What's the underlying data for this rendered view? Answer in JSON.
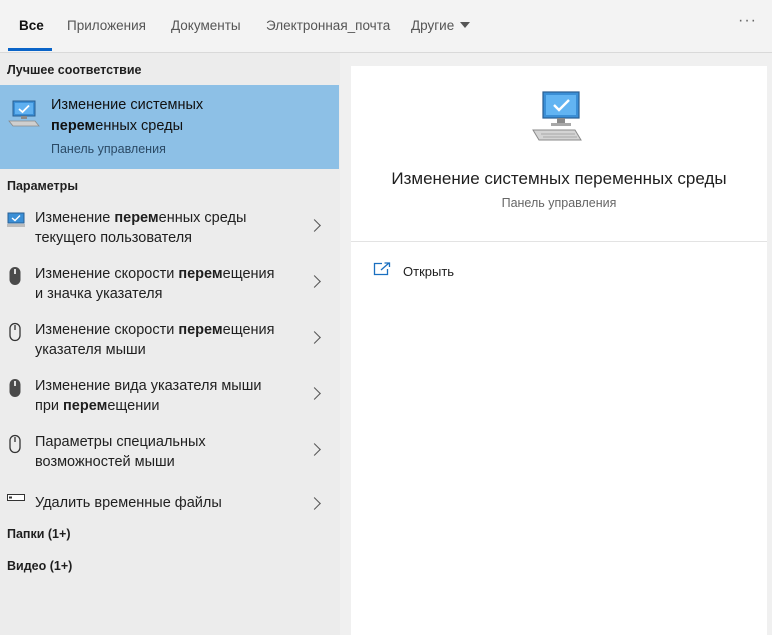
{
  "tabs": [
    {
      "label": "Все",
      "active": true
    },
    {
      "label": "Приложения"
    },
    {
      "label": "Документы"
    },
    {
      "label": "Электронная_почта"
    },
    {
      "label": "Другие"
    }
  ],
  "more_label": "···",
  "best_match": {
    "heading": "Лучшее соответствие",
    "line1": "Изменение системных",
    "line2_bold": "перем",
    "line2_rest": "енных среды",
    "subtitle": "Панель управления"
  },
  "settings": {
    "heading": "Параметры",
    "items": [
      {
        "icon": "monitor-icon",
        "l1_pre": "Изменение ",
        "l1_bold": "перем",
        "l1_post": "енных среды",
        "l2_pre": "текущего пользователя",
        "l2_bold": "",
        "l2_post": ""
      },
      {
        "icon": "mouse-filled-icon",
        "l1_pre": "Изменение скорости ",
        "l1_bold": "перем",
        "l1_post": "ещения",
        "l2_pre": "и значка указателя",
        "l2_bold": "",
        "l2_post": ""
      },
      {
        "icon": "mouse-outline-icon",
        "l1_pre": "Изменение скорости ",
        "l1_bold": "перем",
        "l1_post": "ещения",
        "l2_pre": "указателя мыши",
        "l2_bold": "",
        "l2_post": ""
      },
      {
        "icon": "mouse-filled-icon",
        "l1_pre": "Изменение вида указателя мыши",
        "l1_bold": "",
        "l1_post": "",
        "l2_pre": "при ",
        "l2_bold": "перем",
        "l2_post": "ещении"
      },
      {
        "icon": "mouse-outline-icon",
        "l1_pre": "Параметры специальных",
        "l1_bold": "",
        "l1_post": "",
        "l2_pre": "возможностей мыши",
        "l2_bold": "",
        "l2_post": ""
      },
      {
        "icon": "drive-icon",
        "l1_pre": "Удалить временные файлы",
        "l1_bold": "",
        "l1_post": "",
        "l2_pre": "",
        "l2_bold": "",
        "l2_post": ""
      }
    ]
  },
  "folders_heading": "Папки (1+)",
  "video_heading": "Видео (1+)",
  "detail": {
    "title": "Изменение системных переменных среды",
    "subtitle": "Панель управления",
    "open_label": "Открыть"
  },
  "colors": {
    "accent": "#0a64c8",
    "selected_bg": "#8dc0e6"
  }
}
